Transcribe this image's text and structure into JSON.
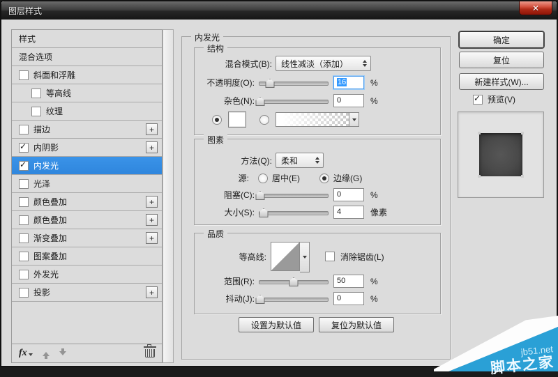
{
  "window": {
    "title": "图层样式",
    "close": "✕"
  },
  "colors": {
    "accent": "#3a93e8",
    "watermark_blue": "#2aa0d6",
    "selection_blue": "#3399ff"
  },
  "sidebar": {
    "items": [
      {
        "label": "样式",
        "checkbox": false,
        "checked": false,
        "indent": false,
        "plus": false,
        "selected": false
      },
      {
        "label": "混合选项",
        "checkbox": false,
        "checked": false,
        "indent": false,
        "plus": false,
        "selected": false
      },
      {
        "label": "斜面和浮雕",
        "checkbox": true,
        "checked": false,
        "indent": false,
        "plus": false,
        "selected": false
      },
      {
        "label": "等高线",
        "checkbox": true,
        "checked": false,
        "indent": true,
        "plus": false,
        "selected": false
      },
      {
        "label": "纹理",
        "checkbox": true,
        "checked": false,
        "indent": true,
        "plus": false,
        "selected": false
      },
      {
        "label": "描边",
        "checkbox": true,
        "checked": false,
        "indent": false,
        "plus": true,
        "selected": false
      },
      {
        "label": "内阴影",
        "checkbox": true,
        "checked": true,
        "indent": false,
        "plus": true,
        "selected": false
      },
      {
        "label": "内发光",
        "checkbox": true,
        "checked": true,
        "indent": false,
        "plus": false,
        "selected": true
      },
      {
        "label": "光泽",
        "checkbox": true,
        "checked": false,
        "indent": false,
        "plus": false,
        "selected": false
      },
      {
        "label": "颜色叠加",
        "checkbox": true,
        "checked": false,
        "indent": false,
        "plus": true,
        "selected": false
      },
      {
        "label": "颜色叠加",
        "checkbox": true,
        "checked": false,
        "indent": false,
        "plus": true,
        "selected": false
      },
      {
        "label": "渐变叠加",
        "checkbox": true,
        "checked": false,
        "indent": false,
        "plus": true,
        "selected": false
      },
      {
        "label": "图案叠加",
        "checkbox": true,
        "checked": false,
        "indent": false,
        "plus": false,
        "selected": false
      },
      {
        "label": "外发光",
        "checkbox": true,
        "checked": false,
        "indent": false,
        "plus": false,
        "selected": false
      },
      {
        "label": "投影",
        "checkbox": true,
        "checked": false,
        "indent": false,
        "plus": true,
        "selected": false
      }
    ],
    "footer": {
      "fx_label": "fx"
    }
  },
  "panel": {
    "title": "内发光",
    "structure": {
      "title": "结构",
      "blend_mode": {
        "label": "混合模式(B):",
        "value": "线性减淡（添加）"
      },
      "opacity": {
        "label": "不透明度(O):",
        "value": "16",
        "unit": "%"
      },
      "noise": {
        "label": "杂色(N):",
        "value": "0",
        "unit": "%"
      }
    },
    "elements": {
      "title": "图素",
      "technique": {
        "label": "方法(Q):",
        "value": "柔和"
      },
      "source": {
        "label": "源:",
        "center": "居中(E)",
        "edge": "边缘(G)",
        "selected": "edge"
      },
      "choke": {
        "label": "阻塞(C):",
        "value": "0",
        "unit": "%"
      },
      "size": {
        "label": "大小(S):",
        "value": "4",
        "unit": "像素"
      }
    },
    "quality": {
      "title": "品质",
      "contour": {
        "label": "等高线:"
      },
      "antialias": {
        "label": "消除锯齿(L)",
        "checked": false
      },
      "range": {
        "label": "范围(R):",
        "value": "50",
        "unit": "%"
      },
      "jitter": {
        "label": "抖动(J):",
        "value": "0",
        "unit": "%"
      }
    },
    "defaults": {
      "make": "设置为默认值",
      "reset": "复位为默认值"
    }
  },
  "actions": {
    "ok": "确定",
    "reset": "复位",
    "new_style": "新建样式(W)...",
    "preview": {
      "label": "预览(V)",
      "checked": true
    }
  },
  "sliders": {
    "opacity": 16,
    "noise": 2,
    "choke": 2,
    "size": 7,
    "range": 50,
    "jitter": 2
  },
  "watermark": {
    "site": "jb51.net",
    "name": "脚本之家"
  }
}
